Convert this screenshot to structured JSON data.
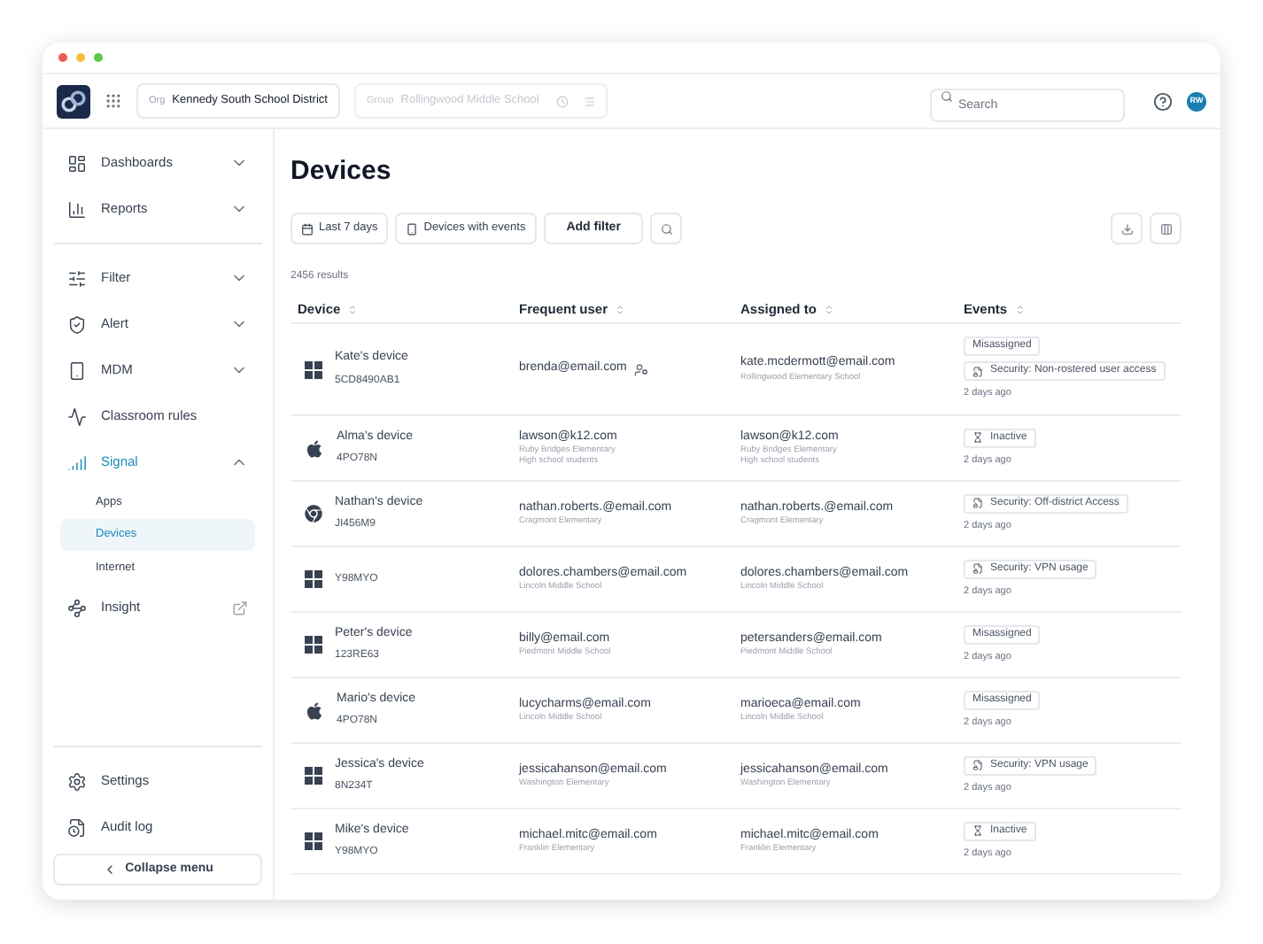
{
  "header": {
    "org_field": {
      "label": "Org",
      "value": "Kennedy South School District",
      "disabled": false
    },
    "group_field": {
      "label": "Group",
      "value": "Rollingwood Middle School",
      "disabled": true
    },
    "search": {
      "placeholder": "Search"
    },
    "avatar": "RW"
  },
  "sidebar": {
    "nav_groups": [
      {
        "items": [
          {
            "label": "Dashboards",
            "kind": "group",
            "expanded": false,
            "active": false
          },
          {
            "label": "Reports",
            "kind": "group",
            "expanded": false,
            "active": false
          }
        ]
      },
      {
        "items": [
          {
            "label": "Filter",
            "kind": "group",
            "expanded": false,
            "active": false
          },
          {
            "label": "Alert",
            "kind": "group",
            "expanded": false,
            "active": false
          },
          {
            "label": "MDM",
            "kind": "group",
            "expanded": false,
            "active": false
          },
          {
            "label": "Classroom rules",
            "kind": "link",
            "active": false
          },
          {
            "label": "Signal",
            "kind": "group",
            "expanded": true,
            "active": true,
            "children": [
              {
                "label": "Apps",
                "selected": false
              },
              {
                "label": "Devices",
                "selected": true
              },
              {
                "label": "Internet",
                "selected": false
              }
            ]
          },
          {
            "label": "Insight",
            "kind": "external",
            "active": false
          }
        ]
      }
    ],
    "footer_items": [
      "Settings",
      "Audit log"
    ],
    "collapse_button": "Collapse menu"
  },
  "page": {
    "title": "Devices",
    "filters": [
      "Last 7 days",
      "Devices with events"
    ],
    "add_filter": "Add filter",
    "results": "2456 results"
  },
  "table": {
    "columns": [
      "Device",
      "Frequent user",
      "Assigned to",
      "Events"
    ],
    "rows": [
      {
        "kind": "windows",
        "name": "Kate's device",
        "serial": "5CD8490AB1",
        "user": "brenda@email.com",
        "user_flagged": true,
        "user_sub": [],
        "assigned": "kate.mcdermott@email.com",
        "assigned_sub": [
          "Rollingwood Elementary School"
        ],
        "events": [
          {
            "kind": "tag",
            "label": "Misassigned"
          },
          {
            "kind": "security",
            "label": "Security: Non-rostered user access"
          }
        ],
        "time": "2 days ago"
      },
      {
        "kind": "apple",
        "name": "Alma's device",
        "serial": "4PO78N",
        "user": "lawson@k12.com",
        "user_flagged": false,
        "user_sub": [
          "Ruby Bridges Elementary",
          "High school students"
        ],
        "assigned": "lawson@k12.com",
        "assigned_sub": [
          "Ruby Bridges Elementary",
          "High school students"
        ],
        "events": [
          {
            "kind": "inactive",
            "label": "Inactive"
          }
        ],
        "time": "2 days ago"
      },
      {
        "kind": "chrome",
        "name": "Nathan's device",
        "serial": "JI456M9",
        "user": "nathan.roberts.@email.com",
        "user_flagged": false,
        "user_sub": [
          "Cragmont Elementary"
        ],
        "assigned": "nathan.roberts.@email.com",
        "assigned_sub": [
          "Cragmont Elementary"
        ],
        "events": [
          {
            "kind": "security",
            "label": "Security: Off-district Access"
          }
        ],
        "time": "2 days ago"
      },
      {
        "kind": "windows",
        "serial": "Y98MYO",
        "user": "dolores.chambers@email.com",
        "user_flagged": false,
        "user_sub": [
          "Lincoln Middle School"
        ],
        "assigned": "dolores.chambers@email.com",
        "assigned_sub": [
          "Lincoln Middle School"
        ],
        "events": [
          {
            "kind": "security",
            "label": "Security: VPN usage"
          }
        ],
        "time": "2 days ago"
      },
      {
        "kind": "windows",
        "name": "Peter's device",
        "serial": "123RE63",
        "user": "billy@email.com",
        "user_flagged": false,
        "user_sub": [
          "Piedmont Middle School"
        ],
        "assigned": "petersanders@email.com",
        "assigned_sub": [
          "Piedmont Middle School"
        ],
        "events": [
          {
            "kind": "tag",
            "label": "Misassigned"
          }
        ],
        "time": "2 days ago"
      },
      {
        "kind": "apple",
        "name": "Mario's device",
        "serial": "4PO78N",
        "user": "lucycharms@email.com",
        "user_flagged": false,
        "user_sub": [
          "Lincoln Middle School"
        ],
        "assigned": "marioeca@email.com",
        "assigned_sub": [
          "Lincoln Middle School"
        ],
        "events": [
          {
            "kind": "tag",
            "label": "Misassigned"
          }
        ],
        "time": "2 days ago"
      },
      {
        "kind": "windows",
        "name": "Jessica's device",
        "serial": "8N234T",
        "user": "jessicahanson@email.com",
        "user_flagged": false,
        "user_sub": [
          "Washington Elementary"
        ],
        "assigned": "jessicahanson@email.com",
        "assigned_sub": [
          "Washington Elementary"
        ],
        "events": [
          {
            "kind": "security",
            "label": "Security: VPN usage"
          }
        ],
        "time": "2 days ago"
      },
      {
        "kind": "windows",
        "name": "Mike's device",
        "serial": "Y98MYO",
        "user": "michael.mitc@email.com",
        "user_flagged": false,
        "user_sub": [
          "Franklin Elementary"
        ],
        "assigned": "michael.mitc@email.com",
        "assigned_sub": [
          "Franklin Elementary"
        ],
        "events": [
          {
            "kind": "inactive",
            "label": "Inactive"
          }
        ],
        "time": "2 days ago"
      }
    ]
  }
}
